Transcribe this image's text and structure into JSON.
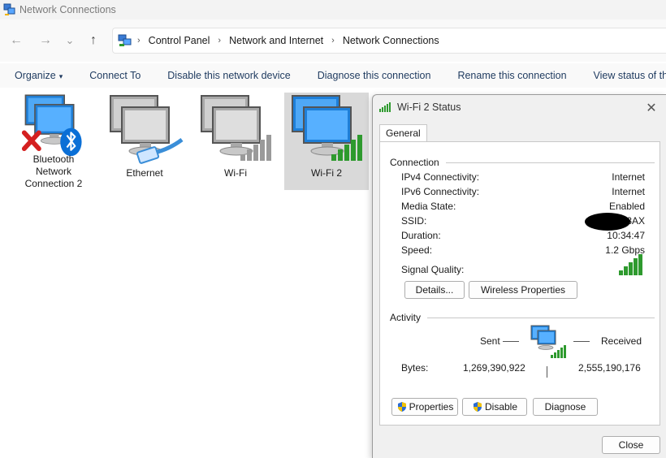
{
  "window": {
    "title": "Network Connections"
  },
  "nav": {
    "back": "←",
    "forward": "→",
    "history": "⌄",
    "up": "↑",
    "breadcrumb": [
      "Control Panel",
      "Network and Internet",
      "Network Connections"
    ],
    "separator": "›"
  },
  "commands": {
    "organize": "Organize",
    "organize_caret": "▾",
    "connect_to": "Connect To",
    "disable_device": "Disable this network device",
    "diagnose": "Diagnose this connection",
    "rename": "Rename this connection",
    "view_status": "View status of this conn"
  },
  "connections": [
    {
      "name": "Bluetooth Network Connection 2",
      "line1": "Bluetooth",
      "line2": "Network",
      "line3": "Connection 2",
      "icon": "bluetooth-disconnected-icon"
    },
    {
      "name": "Ethernet",
      "icon": "ethernet-icon"
    },
    {
      "name": "Wi-Fi",
      "icon": "wifi-inactive-icon"
    },
    {
      "name": "Wi-Fi 2",
      "icon": "wifi-connected-icon",
      "selected": true
    }
  ],
  "dialog": {
    "title": "Wi-Fi 2 Status",
    "close_glyph": "✕",
    "tab": "General",
    "connection_header": "Connection",
    "rows": [
      {
        "key": "IPv4 Connectivity:",
        "value": "Internet"
      },
      {
        "key": "IPv6 Connectivity:",
        "value": "Internet"
      },
      {
        "key": "Media State:",
        "value": "Enabled"
      },
      {
        "key": "SSID:",
        "value": "3AX"
      },
      {
        "key": "Duration:",
        "value": "10:34:47"
      },
      {
        "key": "Speed:",
        "value": "1.2 Gbps"
      }
    ],
    "signal_label": "Signal Quality:",
    "signal_bars": 5,
    "details_button": "Details...",
    "wireless_button": "Wireless Properties",
    "activity_header": "Activity",
    "sent_label": "Sent",
    "received_label": "Received",
    "bytes_label": "Bytes:",
    "bytes_sent": "1,269,390,922",
    "bytes_received": "2,555,190,176",
    "properties_button": "Properties",
    "disable_button": "Disable",
    "diagnose_button": "Diagnose",
    "close_button": "Close"
  },
  "colors": {
    "signal_green": "#2e9a2e",
    "signal_gray": "#9a9a9a",
    "monitor_blue": "#1e7fd8",
    "selection": "#d9d9d9",
    "bluetooth_blue": "#0a6fd6",
    "error_red": "#d42020"
  }
}
